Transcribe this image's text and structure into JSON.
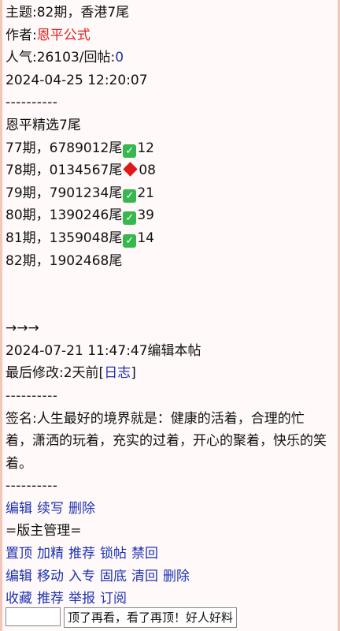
{
  "post": {
    "title": "主题:82期，香港7尾",
    "author_label": "作者:",
    "author_name": "恩平公式",
    "popularity_label": "人气:26103/回帖:",
    "reply_count": "0",
    "datetime": "2024-04-25 12:20:07",
    "divider": "----------"
  },
  "picks": {
    "heading": "恩平精选7尾",
    "rows": [
      {
        "text": "77期，6789012尾",
        "status": "check",
        "result": "12"
      },
      {
        "text": "78期，0134567尾",
        "status": "diamond",
        "result": "08"
      },
      {
        "text": "79期，7901234尾",
        "status": "check",
        "result": "21"
      },
      {
        "text": "80期，1390246尾",
        "status": "check",
        "result": "39"
      },
      {
        "text": "81期，1359048尾",
        "status": "check",
        "result": "14"
      },
      {
        "text": "82期，1902468尾",
        "status": "",
        "result": ""
      }
    ]
  },
  "footer": {
    "arrows": "→→→",
    "edit_time": "2024-07-21 11:47:47编辑本帖",
    "last_modified_label": "最后修改:2天前[",
    "log_link": "日志",
    "last_modified_close": "]",
    "signature": "签名:人生最好的境界就是：健康的活着，合理的忙着，潇洒的玩着，充实的过着，开心的聚着，快乐的笑着。"
  },
  "actions": {
    "row1": [
      "编辑",
      "续写",
      "删除"
    ],
    "moderator_label": "=版主管理=",
    "row2": [
      "置顶",
      "加精",
      "推荐",
      "锁帖",
      "禁回"
    ],
    "row3": [
      "编辑",
      "移动",
      "入专",
      "固底",
      "清回",
      "删除"
    ],
    "row4": [
      "收藏",
      "推荐",
      "举报",
      "订阅"
    ]
  },
  "reply_bar": {
    "input_value": "",
    "quick_reply": "顶了再看，看了再顶！好人好料"
  },
  "colors": {
    "author": "#e02020",
    "link": "#1f33b3",
    "check": "#37b84f",
    "diamond": "#e01818",
    "border": "#f2c7b8"
  },
  "icons": {
    "check": "check-mark-icon",
    "diamond": "red-diamond-icon"
  }
}
